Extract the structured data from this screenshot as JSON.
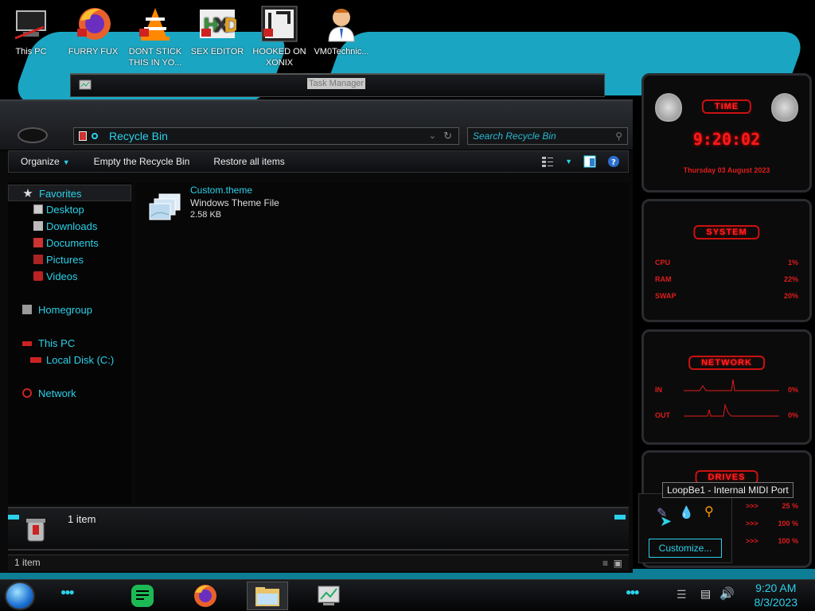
{
  "desktop_icons": [
    {
      "label": "This PC",
      "icon": "computer-icon"
    },
    {
      "label": "FURRY FUX",
      "icon": "firefox-icon"
    },
    {
      "label": "DONT STICK THIS IN YO...",
      "icon": "vlc-icon"
    },
    {
      "label": "SEX EDITOR",
      "icon": "hxd-icon"
    },
    {
      "label": "HOOKED ON XONIX",
      "icon": "game-icon"
    },
    {
      "label": "VM0Technic...",
      "icon": "person-icon"
    }
  ],
  "task_manager": {
    "title": "Task Manager"
  },
  "explorer": {
    "address": "Recycle Bin",
    "search_placeholder": "Search Recycle Bin",
    "toolbar": {
      "organize": "Organize",
      "empty": "Empty the Recycle Bin",
      "restore": "Restore all items"
    },
    "nav": {
      "favorites": "Favorites",
      "desktop": "Desktop",
      "downloads": "Downloads",
      "documents": "Documents",
      "pictures": "Pictures",
      "videos": "Videos",
      "homegroup": "Homegroup",
      "this_pc": "This PC",
      "local_disk": "Local Disk (C:)",
      "network": "Network"
    },
    "file": {
      "name": "Custom.theme",
      "type": "Windows Theme File",
      "size": "2.58 KB"
    },
    "details_count": "1 item",
    "status_count": "1 item"
  },
  "gadgets": {
    "time": {
      "title": "TIME",
      "clock": "9:20:02",
      "date": "Thursday 03 August 2023"
    },
    "system": {
      "title": "SYSTEM",
      "rows": [
        {
          "label": "CPU",
          "value": "1%"
        },
        {
          "label": "RAM",
          "value": "22%"
        },
        {
          "label": "SWAP",
          "value": "20%"
        }
      ]
    },
    "network": {
      "title": "NETWORK",
      "rows": [
        {
          "label": "IN",
          "value": "0%"
        },
        {
          "label": "OUT",
          "value": "0%"
        }
      ]
    },
    "drives": {
      "title": "DRIVES",
      "rows": [
        {
          "label": ">>>",
          "value": "25 %"
        },
        {
          "label": ">>>",
          "value": "100 %"
        },
        {
          "label": ">>>",
          "value": "100 %"
        }
      ]
    }
  },
  "tray_popup": {
    "tooltip": "LoopBe1 - Internal MIDI Port",
    "customize": "Customize..."
  },
  "taskbar": {
    "time": "9:20 AM",
    "date": "8/3/2023",
    "accent": "#2bd1ea"
  }
}
